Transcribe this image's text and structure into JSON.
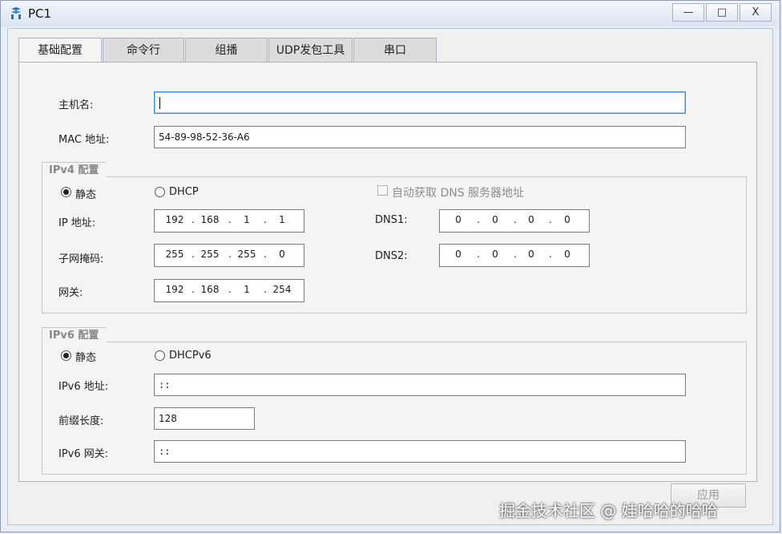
{
  "window": {
    "title": "PC1",
    "minimize": "—",
    "maximize": "□",
    "close": "X"
  },
  "tabs": [
    {
      "label": "基础配置",
      "active": true
    },
    {
      "label": "命令行",
      "active": false
    },
    {
      "label": "组播",
      "active": false
    },
    {
      "label": "UDP发包工具",
      "active": false
    },
    {
      "label": "串口",
      "active": false
    }
  ],
  "basic": {
    "hostname_label": "主机名:",
    "hostname_value": "",
    "mac_label": "MAC 地址:",
    "mac_value": "54-89-98-52-36-A6"
  },
  "ipv4": {
    "title": "IPv4 配置",
    "static_label": "静态",
    "dhcp_label": "DHCP",
    "mode": "static",
    "auto_dns_label": "自动获取 DNS 服务器地址",
    "auto_dns_checked": false,
    "ip_label": "IP 地址:",
    "ip": [
      "192",
      "168",
      "1",
      "1"
    ],
    "mask_label": "子网掩码:",
    "mask": [
      "255",
      "255",
      "255",
      "0"
    ],
    "gateway_label": "网关:",
    "gateway": [
      "192",
      "168",
      "1",
      "254"
    ],
    "dns1_label": "DNS1:",
    "dns1": [
      "0",
      "0",
      "0",
      "0"
    ],
    "dns2_label": "DNS2:",
    "dns2": [
      "0",
      "0",
      "0",
      "0"
    ]
  },
  "ipv6": {
    "title": "IPv6 配置",
    "static_label": "静态",
    "dhcp_label": "DHCPv6",
    "mode": "static",
    "addr_label": "IPv6 地址:",
    "addr_value": "::",
    "prefix_label": "前缀长度:",
    "prefix_value": "128",
    "gateway_label": "IPv6 网关:",
    "gateway_value": "::"
  },
  "apply_label": "应用",
  "watermark": "掘金技术社区 @ 娃哈哈的哈哈"
}
